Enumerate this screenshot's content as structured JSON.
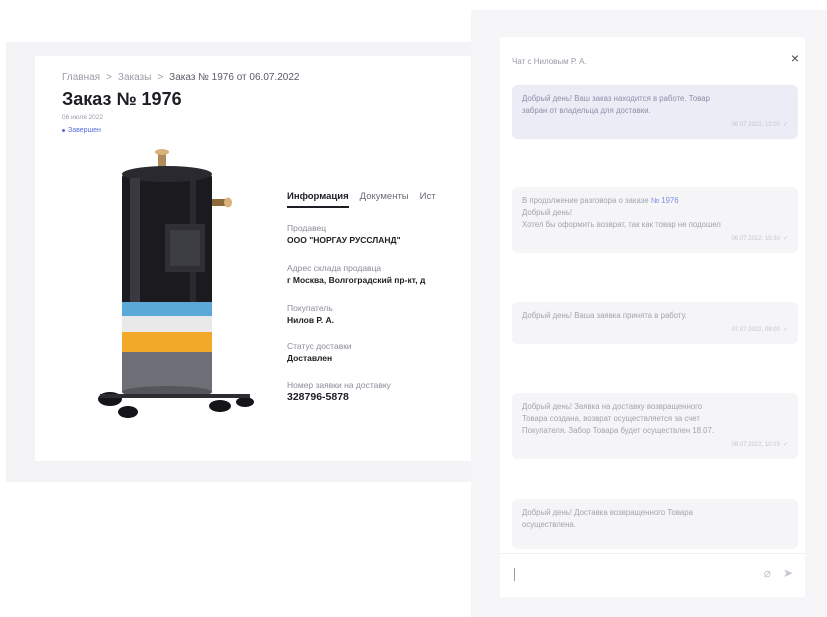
{
  "order": {
    "breadcrumb": [
      {
        "label": "Главная"
      },
      {
        "label": "Заказы"
      },
      {
        "label": "Заказ № 1976 от 06.07.2022"
      }
    ],
    "breadcrumb_separator": ">",
    "title": "Заказ № 1976",
    "date": "06 июля 2022",
    "status": "Завершен",
    "tabs": [
      {
        "label": "Информация",
        "active": true
      },
      {
        "label": "Документы",
        "active": false
      },
      {
        "label": "Ист",
        "active": false
      }
    ],
    "fields": [
      {
        "label": "Продавец",
        "value": "ООО \"НОРГАУ РУССЛАНД\""
      },
      {
        "label": "Адрес склада продавца",
        "value": "г Москва, Волгоградский пр-кт, д"
      },
      {
        "label": "Покупатель",
        "value": "Нилов Р. А."
      },
      {
        "label": "Статус доставки",
        "value": "Доставлен"
      },
      {
        "label": "Номер заявки на доставку",
        "value": "328796-5878"
      }
    ],
    "product_image_alt": "compressor-photo"
  },
  "chat": {
    "title": "Чат с Ниловым Р. А.",
    "close_icon": "close-icon",
    "messages": [
      {
        "direction": "outgoing",
        "lines": [
          "Добрый день! Ваш заказ находится в работе. Товар",
          "забран от владельца для доставки."
        ],
        "meta": "06.07.2022, 12:00"
      },
      {
        "direction": "incoming",
        "lines_prefix": "В продолжение разговора о заказе ",
        "link": "№ 1976",
        "lines": [
          "Добрый день!",
          "Хотел бы оформить возврат, так как товар не подошел"
        ],
        "meta": "06.07.2022, 15:30"
      },
      {
        "direction": "incoming",
        "lines": [
          "Добрый день! Ваша заявка принята в работу."
        ],
        "meta": "07.07.2022, 09:00"
      },
      {
        "direction": "incoming",
        "lines": [
          "Добрый день! Заявка на доставку возвращенного",
          "Товара создана, возврат осуществляется за счет",
          "Покупателя. Забор Товара будет осуществлен 18.07."
        ],
        "meta": "08.07.2022, 10:15"
      },
      {
        "direction": "incoming",
        "lines": [
          "Добрый день! Доставка возвращенного Товара",
          "осуществлена."
        ],
        "meta": ""
      }
    ],
    "input": {
      "value": ""
    },
    "attach_icon": "paperclip-icon",
    "send_icon": "send-icon"
  },
  "colors": {
    "accent": "#5a6bdc",
    "title_text": "#1d1e24",
    "bubble_outgoing": "#ececf6",
    "bubble_incoming": "#f5f5f7"
  }
}
